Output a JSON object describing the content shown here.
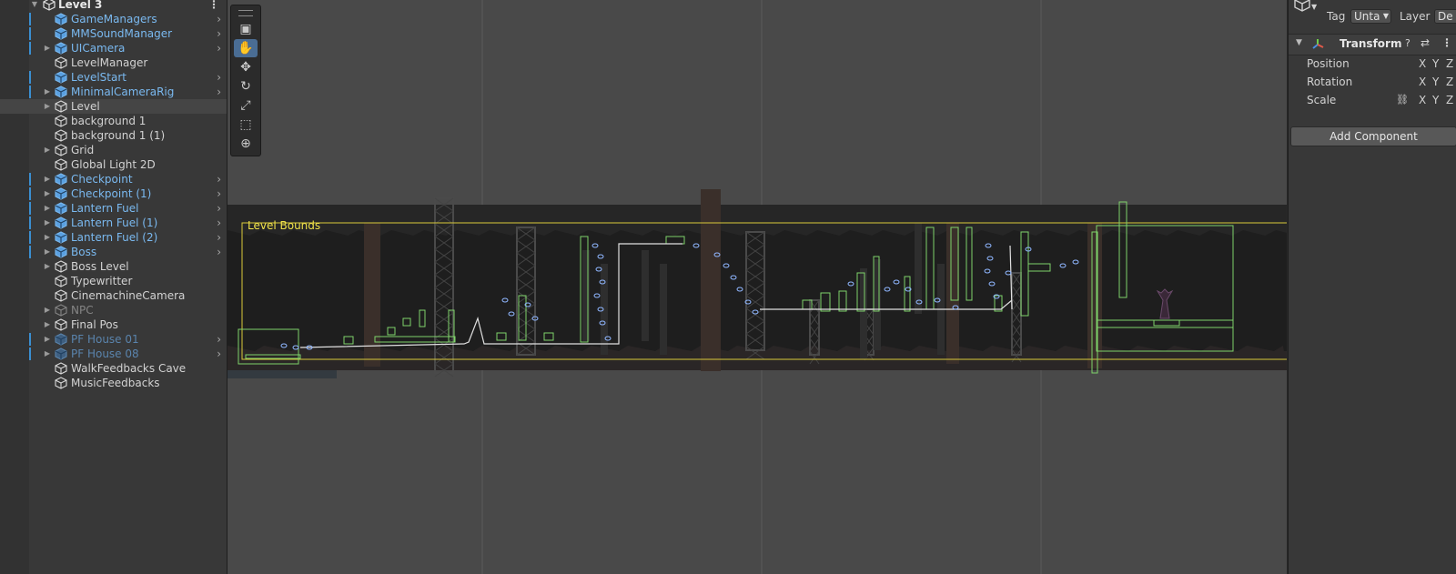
{
  "hierarchy": {
    "root_label": "Level 3",
    "items": [
      {
        "label": "GameManagers",
        "prefab": true,
        "inactive": false,
        "fold": false,
        "chevron": true,
        "pbar": true
      },
      {
        "label": "MMSoundManager",
        "prefab": true,
        "inactive": false,
        "fold": false,
        "chevron": true,
        "pbar": true
      },
      {
        "label": "UICamera",
        "prefab": true,
        "inactive": false,
        "fold": true,
        "chevron": true,
        "pbar": true
      },
      {
        "label": "LevelManager",
        "prefab": false,
        "inactive": false,
        "fold": false,
        "chevron": false,
        "pbar": false
      },
      {
        "label": "LevelStart",
        "prefab": true,
        "inactive": false,
        "fold": false,
        "chevron": true,
        "pbar": true
      },
      {
        "label": "MinimalCameraRig",
        "prefab": true,
        "inactive": false,
        "fold": true,
        "chevron": true,
        "pbar": true
      },
      {
        "label": "Level",
        "prefab": false,
        "inactive": false,
        "fold": true,
        "chevron": false,
        "pbar": false,
        "selected": true
      },
      {
        "label": "background 1",
        "prefab": false,
        "inactive": false,
        "fold": false,
        "chevron": false,
        "pbar": false
      },
      {
        "label": "background 1 (1)",
        "prefab": false,
        "inactive": false,
        "fold": false,
        "chevron": false,
        "pbar": false
      },
      {
        "label": "Grid",
        "prefab": false,
        "inactive": false,
        "fold": true,
        "chevron": false,
        "pbar": false
      },
      {
        "label": "Global Light 2D",
        "prefab": false,
        "inactive": false,
        "fold": false,
        "chevron": false,
        "pbar": false
      },
      {
        "label": "Checkpoint",
        "prefab": true,
        "inactive": false,
        "fold": true,
        "chevron": true,
        "pbar": true
      },
      {
        "label": "Checkpoint (1)",
        "prefab": true,
        "inactive": false,
        "fold": true,
        "chevron": true,
        "pbar": true
      },
      {
        "label": "Lantern Fuel",
        "prefab": true,
        "inactive": false,
        "fold": true,
        "chevron": true,
        "pbar": true
      },
      {
        "label": "Lantern Fuel (1)",
        "prefab": true,
        "inactive": false,
        "fold": true,
        "chevron": true,
        "pbar": true
      },
      {
        "label": "Lantern Fuel (2)",
        "prefab": true,
        "inactive": false,
        "fold": true,
        "chevron": true,
        "pbar": true
      },
      {
        "label": "Boss",
        "prefab": true,
        "inactive": false,
        "fold": true,
        "chevron": true,
        "pbar": true
      },
      {
        "label": "Boss Level",
        "prefab": false,
        "inactive": false,
        "fold": true,
        "chevron": false,
        "pbar": false
      },
      {
        "label": "Typewritter",
        "prefab": false,
        "inactive": false,
        "fold": false,
        "chevron": false,
        "pbar": false
      },
      {
        "label": "CinemachineCamera",
        "prefab": false,
        "inactive": false,
        "fold": false,
        "chevron": false,
        "pbar": false
      },
      {
        "label": "NPC",
        "prefab": false,
        "inactive": true,
        "fold": true,
        "chevron": false,
        "pbar": false
      },
      {
        "label": "Final Pos",
        "prefab": false,
        "inactive": false,
        "fold": true,
        "chevron": false,
        "pbar": false
      },
      {
        "label": "PF House 01",
        "prefab": true,
        "inactive": true,
        "fold": true,
        "chevron": true,
        "pbar": true
      },
      {
        "label": "PF House 08",
        "prefab": true,
        "inactive": true,
        "fold": true,
        "chevron": true,
        "pbar": true
      },
      {
        "label": "WalkFeedbacks Cave",
        "prefab": false,
        "inactive": false,
        "fold": false,
        "chevron": false,
        "pbar": false
      },
      {
        "label": "MusicFeedbacks",
        "prefab": false,
        "inactive": false,
        "fold": false,
        "chevron": false,
        "pbar": false
      }
    ]
  },
  "scene": {
    "bounds_label": "Level Bounds",
    "tools": [
      {
        "icon": "view-cube-icon",
        "glyph": "▣",
        "active": false
      },
      {
        "icon": "hand-tool-icon",
        "glyph": "✋",
        "active": true
      },
      {
        "icon": "move-tool-icon",
        "glyph": "✥",
        "active": false
      },
      {
        "icon": "rotate-tool-icon",
        "glyph": "↻",
        "active": false
      },
      {
        "icon": "scale-tool-icon",
        "glyph": "⤢",
        "active": false
      },
      {
        "icon": "rect-tool-icon",
        "glyph": "⬚",
        "active": false
      },
      {
        "icon": "transform-tool-icon",
        "glyph": "⊕",
        "active": false
      }
    ]
  },
  "inspector": {
    "tag_label": "Tag",
    "tag_value": "Unta",
    "layer_label": "Layer",
    "layer_value": "De",
    "component_title": "Transform",
    "properties": [
      {
        "label": "Position",
        "link": false
      },
      {
        "label": "Rotation",
        "link": false
      },
      {
        "label": "Scale",
        "link": true
      }
    ],
    "axes": [
      "X",
      "Y",
      "Z"
    ],
    "add_component": "Add Component"
  }
}
